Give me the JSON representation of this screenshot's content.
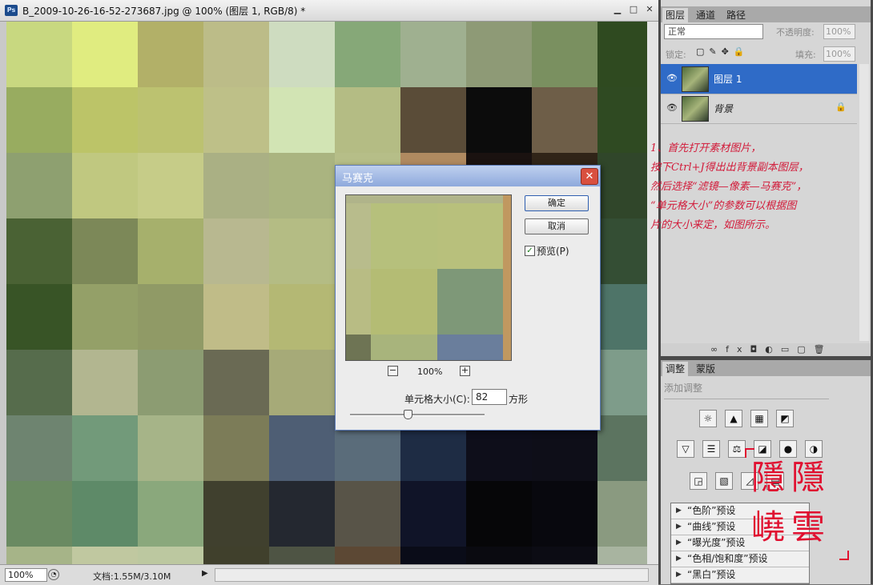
{
  "document": {
    "title": "B_2009-10-26-16-52-273687.jpg @ 100% (图层 1, RGB/8) *",
    "app_icon": "Ps",
    "zoom": "100%",
    "doc_info": "文档:1.55M/3.10M"
  },
  "mosaic_colors": [
    [
      "#c8d880",
      "#e0ec80",
      "#b2b068",
      "#bcbc88",
      "#cedcc0",
      "#86a878",
      "#9fb090",
      "#8e9a76",
      "#7a9060",
      "#2f4a20"
    ],
    [
      "#98ac60",
      "#bcc468",
      "#bcc270",
      "#bec088",
      "#d2e4b4",
      "#b4bc84",
      "#5a4c38",
      "#0c0c0c",
      "#6e5e48",
      "#2f4a22"
    ],
    [
      "#8ea070",
      "#c0c880",
      "#c6cc88",
      "#aab084",
      "#aab480",
      "#b6be88",
      "#b08a60",
      "#1a1210",
      "#302418",
      "#30462a"
    ],
    [
      "#4a6234",
      "#7c8858",
      "#a6b06c",
      "#b8b890",
      "#b4bc84",
      "#a8b07c",
      "#9cac80",
      "#7a8a6a",
      "#5a6a50",
      "#344e34"
    ],
    [
      "#385426",
      "#94a068",
      "#909a66",
      "#c0bc88",
      "#b4b874",
      "#a6ae7c",
      "#8c9a76",
      "#6e8a6c",
      "#5a786a",
      "#4e7468"
    ],
    [
      "#566c4c",
      "#b2b690",
      "#8c9c72",
      "#6a6a54",
      "#a6aa78",
      "#9aa880",
      "#7c9474",
      "#6c8870",
      "#5e7a6a",
      "#7e9c8a"
    ],
    [
      "#6e8470",
      "#729a7a",
      "#a6b488",
      "#7c7c58",
      "#4e5e74",
      "#5a6c7a",
      "#1e2c44",
      "#0e0e1a",
      "#0e0e18",
      "#5c7460"
    ],
    [
      "#6a8a62",
      "#5e8a68",
      "#8aa87c",
      "#40402e",
      "#242830",
      "#585448",
      "#101428",
      "#060608",
      "#08080e",
      "#8a9a80"
    ],
    [
      "#a6b488",
      "#c0c8a0",
      "#bcc8a0",
      "#40402c",
      "#4e5444",
      "#5c4834",
      "#0a0c18",
      "#0a0a10",
      "#0c0c14",
      "#a8b4a0"
    ]
  ],
  "dialog": {
    "title": "马赛克",
    "ok": "确定",
    "cancel": "取消",
    "preview_label": "预览(P)",
    "preview_checked": "✓",
    "zoom": "100%",
    "zoom_minus": "−",
    "zoom_plus": "+",
    "cell_size_label": "单元格大小(C):",
    "cell_size_value": "82",
    "cell_unit": "方形",
    "cell_size_slider_fraction": 0.42,
    "preview_colors": [
      "#b8bc8c",
      "#b6c07c",
      "#b8c07c",
      "#c09860",
      "#b8bc84",
      "#b4bc74",
      "#7e9878",
      "#c09860",
      "#6e7454",
      "#a8b47c",
      "#6a7e9c",
      "#c09860"
    ]
  },
  "layers_panel": {
    "tabs": [
      "图层",
      "通道",
      "路径"
    ],
    "blend_mode": "正常",
    "opacity_label": "不透明度:",
    "opacity": "100%",
    "lock_label": "锁定:",
    "fill_label": "填充:",
    "fill": "100%",
    "layers": [
      {
        "name": "图层 1",
        "selected": true
      },
      {
        "name": "背景",
        "selected": false,
        "locked": true
      }
    ]
  },
  "annotation_lines": [
    "1、首先打开素材图片，",
    "按下Ctrl+J得出出背景副本图层，",
    "然后选择“滤镜—像素—马赛克”，",
    "“单元格大小”的参数可以根据图",
    "片的大小来定，如图所示。"
  ],
  "adjustments_panel": {
    "tabs": [
      "调整",
      "蒙版"
    ],
    "add_label": "添加调整",
    "presets": [
      "“色阶”预设",
      "“曲线”预设",
      "“曝光度”预设",
      "“色相/饱和度”预设",
      "“黑白”预设"
    ]
  },
  "seal_text": "隱隱嶢雲",
  "colors": {
    "selection": "#2f6bc7",
    "annotation": "#d21b3a",
    "dialog_title": "#8ea9dc"
  }
}
